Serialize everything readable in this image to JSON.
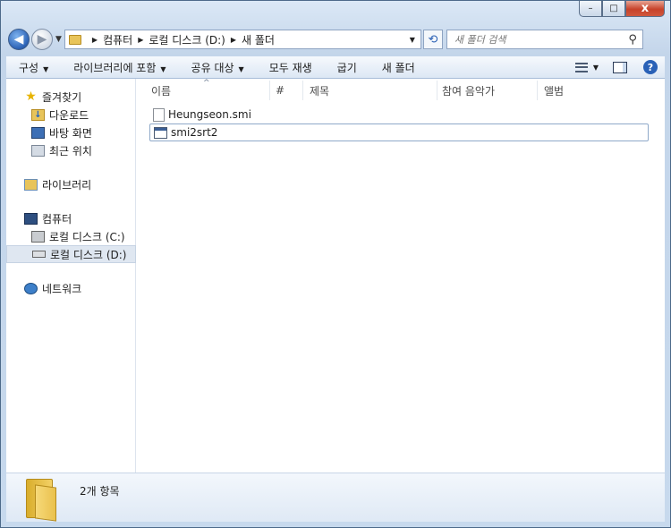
{
  "window": {
    "caption_buttons": {
      "minimize": "–",
      "maximize": "□",
      "close": "x"
    }
  },
  "navigation": {
    "back_glyph": "◀",
    "forward_glyph": "▶",
    "breadcrumb": [
      "컴퓨터",
      "로컬 디스크 (D:)",
      "새 폴더"
    ],
    "refresh_icon": "refresh-icon",
    "search_placeholder": "새 폴더 검색"
  },
  "toolbar": {
    "organize": "구성",
    "include_library": "라이브러리에 포함",
    "share_with": "공유 대상",
    "play_all": "모두 재생",
    "burn": "굽기",
    "new_folder": "새 폴더"
  },
  "sidebar": {
    "favorites": {
      "label": "즐겨찾기",
      "items": [
        "다운로드",
        "바탕 화면",
        "최근 위치"
      ]
    },
    "libraries": {
      "label": "라이브러리"
    },
    "computer": {
      "label": "컴퓨터",
      "items": [
        "로컬 디스크 (C:)",
        "로컬 디스크 (D:)"
      ],
      "selected": "로컬 디스크 (D:)"
    },
    "network": {
      "label": "네트워크"
    }
  },
  "columns": [
    "이름",
    "#",
    "제목",
    "참여 음악가",
    "앨범"
  ],
  "files": [
    {
      "name": "Heungseon.smi",
      "icon": "document-icon"
    },
    {
      "name": "smi2srt2",
      "icon": "application-icon"
    }
  ],
  "status": {
    "item_count": "2개 항목"
  },
  "colors": {
    "accent": "#2c62b5",
    "close_button": "#c7422a",
    "window_frame": "#c3d5ea"
  }
}
